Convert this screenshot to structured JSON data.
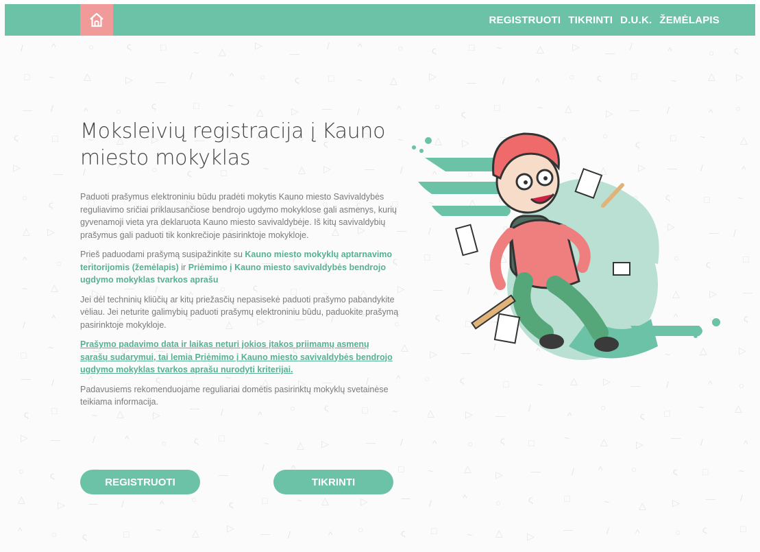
{
  "header": {
    "nav": [
      "REGISTRUOTI",
      "TIKRINTI",
      "D.U.K.",
      "ŽEMĖLAPIS"
    ]
  },
  "main": {
    "title": "Moksleivių registracija į Kauno miesto mokyklas",
    "p1": "Paduoti prašymus elektroniniu būdu pradėti mokytis Kauno miesto Savivaldybės reguliavimo sričiai priklausančiose bendrojo ugdymo mokyklose gali asmenys, kurių gyvenamoji vieta yra deklaruota Kauno miesto savivaldybėje. Iš kitų savivaldybių prašymus gali paduoti tik konkrečioje pasirinktoje mokykloje.",
    "p2_pre": "Prieš paduodami prašymą susipažinkite su ",
    "p2_link1": "Kauno miesto mokyklų aptarnavimo teritorijomis (žemėlapis)",
    "p2_mid": " ir ",
    "p2_link2": "Priėmimo į Kauno miesto savivaldybės bendrojo ugdymo mokyklas tvarkos aprašu",
    "p3": "Jei dėl techninių kliūčių ar kitų priežasčių nepasisekė paduoti prašymo pabandykite vėliau. Jei neturite galimybių paduoti prašymų elektroniniu būdu, paduokite prašymą pasirinktoje mokykloje.",
    "p4": "Prašymo padavimo data ir laikas neturi jokios įtakos priimamų asmenų sąrašų sudarymui, tai lemia Priėmimo į Kauno miesto savivaldybės bendrojo ugdymo mokyklas tvarkos aprašu nurodyti kriterijai.",
    "p5": "Padavusiems rekomenduojame reguliariai domėtis pasirinktų mokyklų svetainėse teikiama informacija."
  },
  "buttons": {
    "register": "REGISTRUOTI",
    "check": "TIKRINTI"
  },
  "colors": {
    "accent": "#6cc2a6",
    "home": "#f09a9a",
    "link": "#57b191"
  },
  "icons": {
    "home": "home-icon"
  }
}
